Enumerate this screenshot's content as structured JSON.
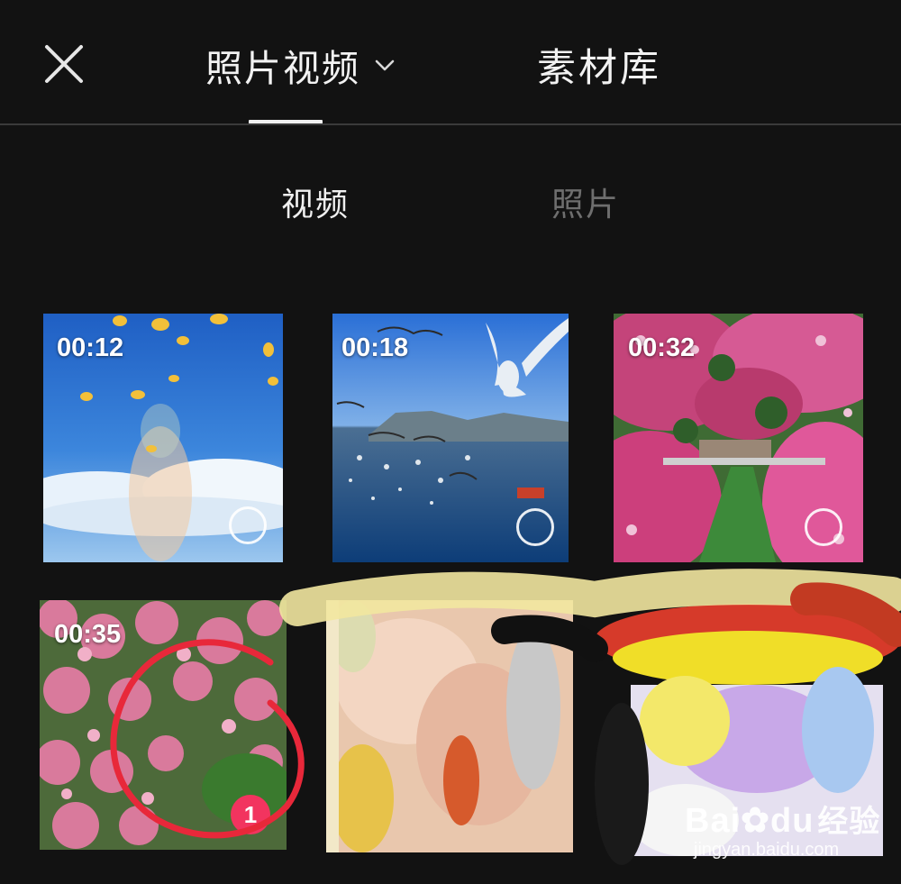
{
  "header": {
    "close_icon": "close-icon",
    "tab_photos_videos": "照片视频",
    "tab_library": "素材库",
    "chevron_icon": "chevron-down-icon"
  },
  "subtabs": {
    "video": "视频",
    "photo": "照片"
  },
  "media": [
    {
      "duration": "00:12",
      "selected": false
    },
    {
      "duration": "00:18",
      "selected": false
    },
    {
      "duration": "00:32",
      "selected": false
    },
    {
      "duration": "00:35",
      "selected": true,
      "selection_index": "1"
    }
  ],
  "watermark": {
    "brand": "Bai",
    "brand_end": "du",
    "brand_cn": "经验",
    "url": "jingyan.baidu.com"
  },
  "colors": {
    "background": "#121212",
    "badge": "#f2345f",
    "annotation_red": "#e8283a"
  }
}
